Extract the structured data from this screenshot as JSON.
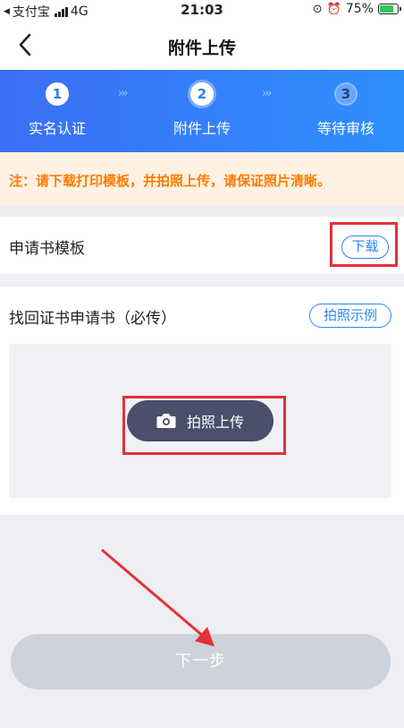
{
  "status_bar": {
    "carrier": "支付宝",
    "network": "4G",
    "time": "21:03",
    "battery": "75%",
    "battery_level": 0.75
  },
  "nav": {
    "title": "附件上传"
  },
  "steps": [
    {
      "number": "1",
      "label": "实名认证",
      "state": "done"
    },
    {
      "number": "2",
      "label": "附件上传",
      "state": "active"
    },
    {
      "number": "3",
      "label": "等待审核",
      "state": "pending"
    }
  ],
  "step_separator": "›››",
  "notice": "注：请下载打印模板，并拍照上传，请保证照片清晰。",
  "template": {
    "label": "申请书模板",
    "download_label": "下载"
  },
  "upload": {
    "title": "找回证书申请书（必传）",
    "example_label": "拍照示例",
    "photo_label": "拍照上传"
  },
  "footer": {
    "next_label": "下一步"
  },
  "colors": {
    "accent": "#2e86f6",
    "notice_text": "#ff7a00",
    "annotation": "#e3303a"
  }
}
